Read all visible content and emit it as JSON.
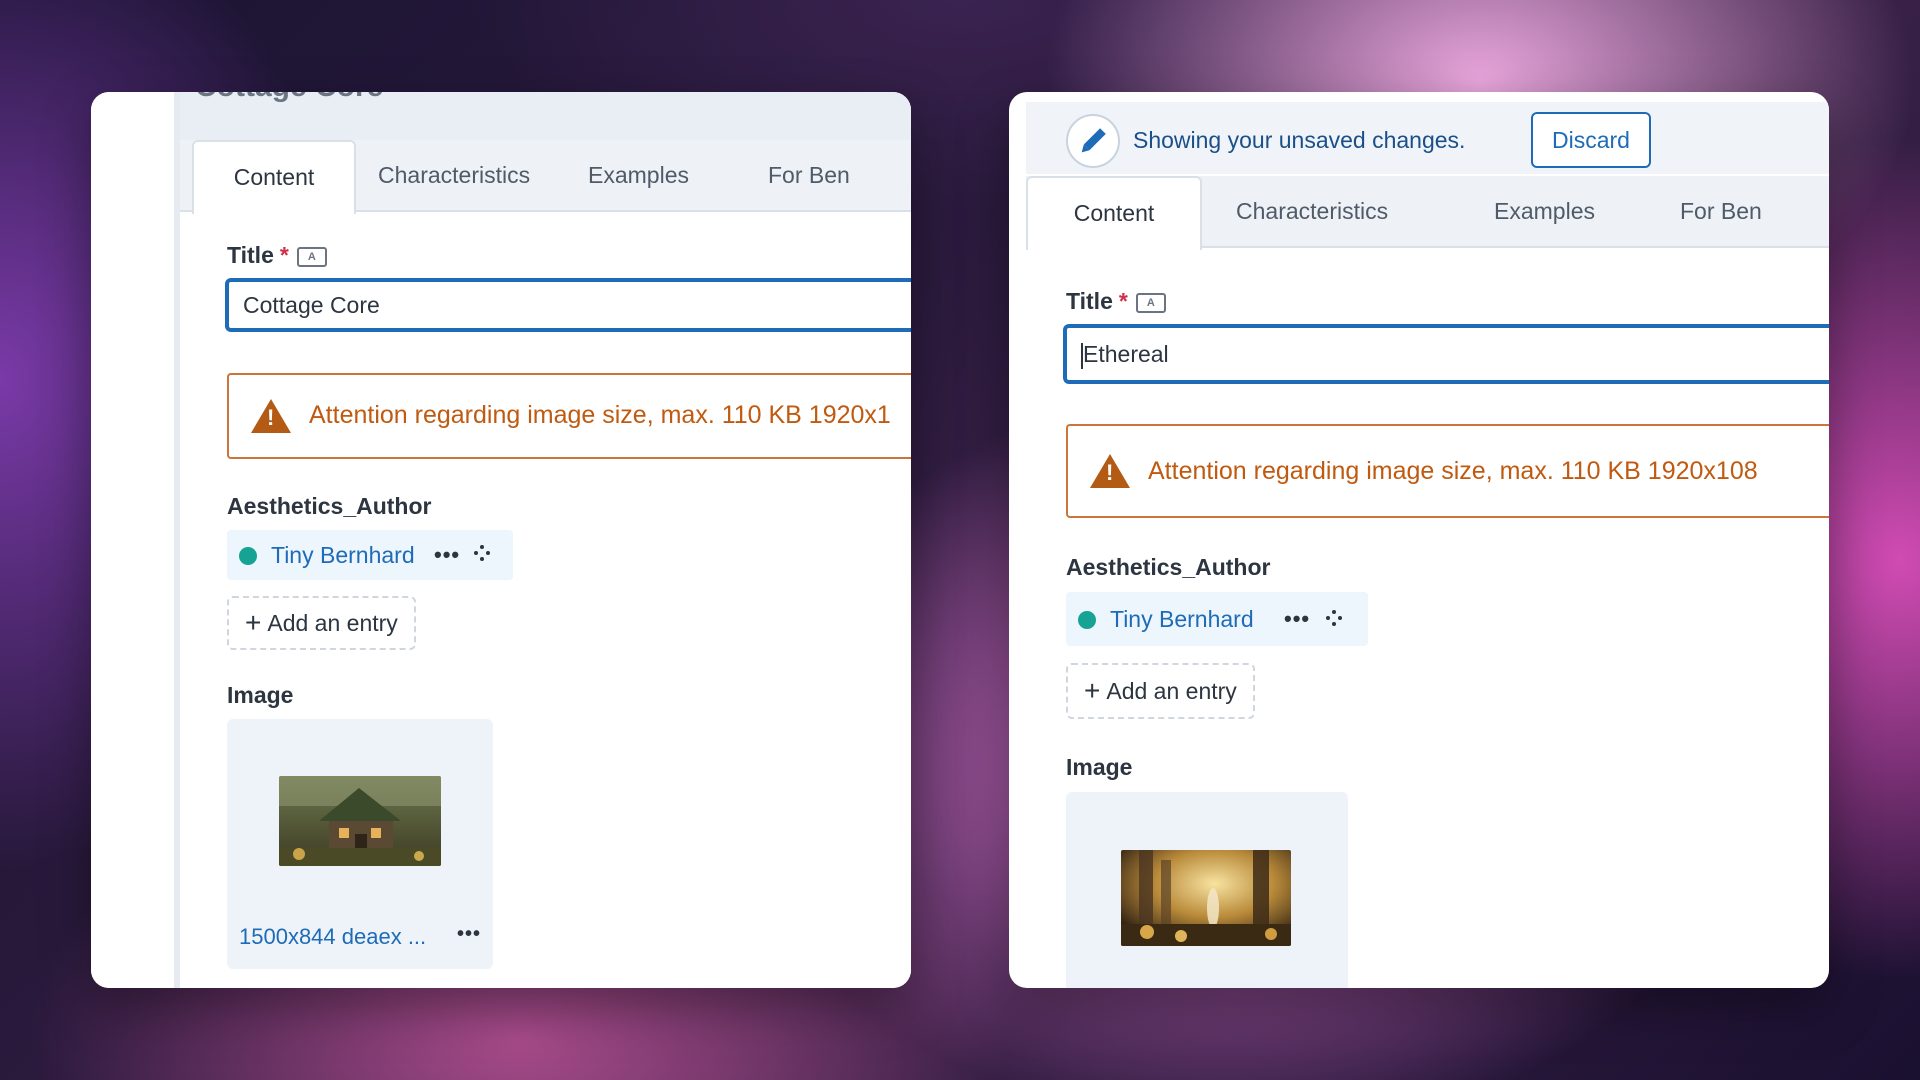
{
  "left": {
    "page_title_partial": "Cottage Core",
    "tabs": [
      "Content",
      "Characteristics",
      "Examples",
      "For Ben"
    ],
    "title_label": "Title",
    "required_mark": "*",
    "lang_badge": "A",
    "title_value": "Cottage Core",
    "warning_text": "Attention regarding image size, max. 110 KB 1920x1",
    "author_label": "Aesthetics_Author",
    "author_name": "Tiny Bernhard",
    "ellipsis": "•••",
    "add_entry": "Add an entry",
    "image_label": "Image",
    "file_name": "1500x844 deaex ...",
    "file_menu": "•••"
  },
  "right": {
    "unsaved_text": "Showing your unsaved changes.",
    "discard": "Discard",
    "tabs": [
      "Content",
      "Characteristics",
      "Examples",
      "For Ben"
    ],
    "title_label": "Title",
    "required_mark": "*",
    "lang_badge": "A",
    "title_value": "Ethereal",
    "warning_text": "Attention regarding image size, max. 110 KB 1920x108",
    "author_label": "Aesthetics_Author",
    "author_name": "Tiny Bernhard",
    "ellipsis": "•••",
    "add_entry": "Add an entry",
    "image_label": "Image"
  },
  "colors": {
    "accent": "#1e6bb8",
    "warning": "#c05a10",
    "required": "#d0304a",
    "status_dot": "#16a394"
  },
  "icons": [
    "pencil-icon",
    "warning-icon",
    "drag-handle-icon",
    "plus-icon",
    "translate-icon",
    "more-icon"
  ]
}
